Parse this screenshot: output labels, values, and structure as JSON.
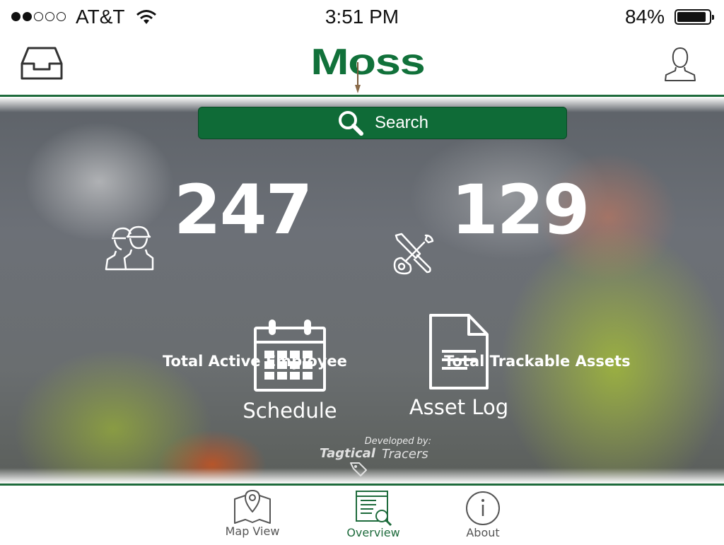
{
  "status_bar": {
    "carrier": "AT&T",
    "time": "3:51 PM",
    "battery_percent": "84%",
    "signal_bars_filled": 2,
    "signal_bars_total": 5
  },
  "header": {
    "logo_text": "Moss",
    "left_icon": "inbox-icon",
    "right_icon": "user-profile-icon"
  },
  "search": {
    "label": "Search",
    "icon": "search-icon"
  },
  "stats": [
    {
      "value": "247",
      "label": "Total Active Employee",
      "icon": "workers-hardhat-icon"
    },
    {
      "value": "129",
      "label": "Total Trackable Assets",
      "icon": "tools-icon"
    }
  ],
  "tiles": [
    {
      "label": "Schedule",
      "icon": "calendar-icon"
    },
    {
      "label": "Asset Log",
      "icon": "document-icon"
    }
  ],
  "credit": {
    "developed_by": "Developed by:",
    "brand_bold": "Tagtical",
    "brand_light": "Tracers"
  },
  "tab_bar": {
    "tabs": [
      {
        "label": "Map View",
        "icon": "map-pin-icon",
        "active": false
      },
      {
        "label": "Overview",
        "icon": "overview-icon",
        "active": true
      },
      {
        "label": "About",
        "icon": "info-icon",
        "active": false
      }
    ]
  },
  "colors": {
    "brand_green": "#11713a",
    "divider_green": "#1e6b3c",
    "search_bg": "#0f6b37"
  }
}
